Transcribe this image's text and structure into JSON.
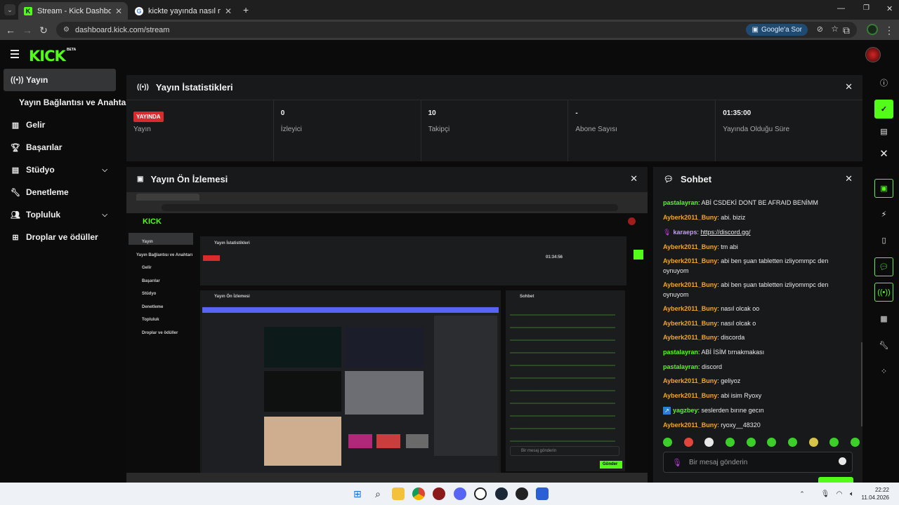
{
  "browser": {
    "tabs": [
      {
        "title": "Stream - Kick Dashboard",
        "active": true
      },
      {
        "title": "kickte yayında nasıl moderatör",
        "active": false
      }
    ],
    "url": "dashboard.kick.com/stream",
    "ask_label": "Google'a Sor"
  },
  "brand": {
    "logo": "KICK",
    "badge": "BETA",
    "accent": "#53fc18"
  },
  "sidebar": {
    "items": [
      {
        "label": "Yayın",
        "icon": "broadcast-icon",
        "active": true
      },
      {
        "label": "Yayın Bağlantısı ve Anahtarı",
        "icon": "",
        "sub": true
      },
      {
        "label": "Gelir",
        "icon": "chart-icon"
      },
      {
        "label": "Başarılar",
        "icon": "trophy-icon"
      },
      {
        "label": "Stüdyo",
        "icon": "studio-icon",
        "expandable": true
      },
      {
        "label": "Denetleme",
        "icon": "wrench-icon"
      },
      {
        "label": "Topluluk",
        "icon": "community-icon",
        "expandable": true
      },
      {
        "label": "Droplar ve ödüller",
        "icon": "drops-icon"
      }
    ]
  },
  "stats": {
    "title": "Yayın İstatistikleri",
    "live_badge": "YAYINDA",
    "cells": [
      {
        "value": "",
        "label": "Yayın"
      },
      {
        "value": "0",
        "label": "İzleyici"
      },
      {
        "value": "10",
        "label": "Takipçi"
      },
      {
        "value": "-",
        "label": "Abone Sayısı"
      },
      {
        "value": "01:35:00",
        "label": "Yayında Olduğu Süre"
      }
    ]
  },
  "preview": {
    "title": "Yayın Ön İzlemesi",
    "inner": {
      "stats_title": "Yayın İstatistikleri",
      "preview_title": "Yayın Ön İzlemesi",
      "chat_title": "Sohbet",
      "uptime": "01:34:56",
      "send": "Gönder",
      "placeholder": "Bir mesaj gönderin"
    }
  },
  "chat": {
    "title": "Sohbet",
    "messages": [
      {
        "user": "pastalayran",
        "text": "ABİ CSDEKİ DONT BE AFRAID BENİMM",
        "color": "#53fc18"
      },
      {
        "user": "Ayberk2011_Buny",
        "text": "abi. biziz",
        "color": "#f5a623"
      },
      {
        "user": "karaeps",
        "text": "https://discord.gg/",
        "color": "#c39cff",
        "badge": "mic"
      },
      {
        "user": "Ayberk2011_Buny",
        "text": "tm abi",
        "color": "#f5a623"
      },
      {
        "user": "Ayberk2011_Buny",
        "text": "abi ben şuan tabletten izliyommpc den oynuyom",
        "color": "#f5a623"
      },
      {
        "user": "Ayberk2011_Buny",
        "text": "abi ben şuan tabletten izliyommpc den oynuyom",
        "color": "#f5a623"
      },
      {
        "user": "Ayberk2011_Buny",
        "text": "nasıl olcak oo",
        "color": "#f5a623"
      },
      {
        "user": "Ayberk2011_Buny",
        "text": "nasıl olcak o",
        "color": "#f5a623"
      },
      {
        "user": "Ayberk2011_Buny",
        "text": "discorda",
        "color": "#f5a623"
      },
      {
        "user": "pastalayran",
        "text": "ABİ İSİM tırnakmakası",
        "color": "#53fc18"
      },
      {
        "user": "pastalayran",
        "text": "discord",
        "color": "#53fc18"
      },
      {
        "user": "Ayberk2011_Buny",
        "text": "geliyoz",
        "color": "#f5a623"
      },
      {
        "user": "Ayberk2011_Buny",
        "text": "abi isim Ryoxy",
        "color": "#f5a623"
      },
      {
        "user": "yagzbey",
        "text": "seslerden bırıne gecın",
        "color": "#53fc18",
        "badge": "bolt"
      },
      {
        "user": "Ayberk2011_Buny",
        "text": "ryoxy__48320",
        "color": "#f5a623"
      }
    ],
    "placeholder": "Bir mesaj gönderin"
  },
  "taskbar": {
    "time": "22:22",
    "date": "11.04.2026"
  }
}
